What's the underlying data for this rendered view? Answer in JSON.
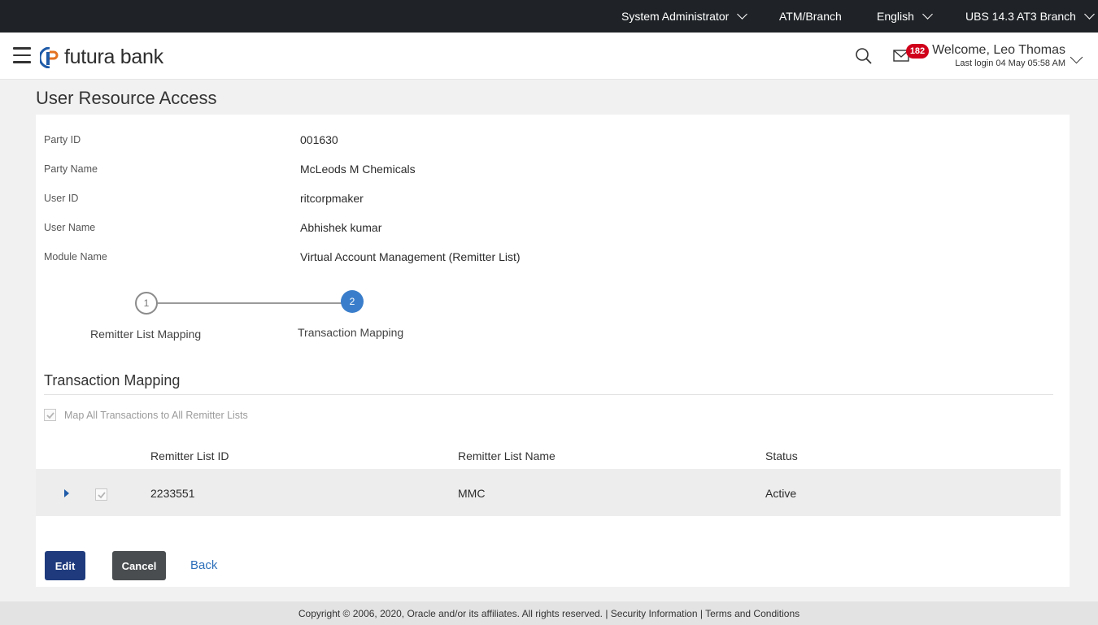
{
  "topbar": {
    "role": "System Administrator",
    "atm_branch": "ATM/Branch",
    "language": "English",
    "branch": "UBS 14.3 AT3 Branch"
  },
  "header": {
    "logo_text": "futura bank",
    "notification_count": "182",
    "welcome": "Welcome, Leo Thomas",
    "last_login": "Last login 04 May 05:58 AM"
  },
  "page": {
    "title": "User Resource Access"
  },
  "details": [
    {
      "label": "Party ID",
      "value": "001630"
    },
    {
      "label": "Party Name",
      "value": "McLeods M Chemicals"
    },
    {
      "label": "User ID",
      "value": "ritcorpmaker"
    },
    {
      "label": "User Name",
      "value": "Abhishek kumar"
    },
    {
      "label": "Module Name",
      "value": "Virtual Account Management (Remitter List)"
    }
  ],
  "stepper": {
    "steps": [
      {
        "number": "1",
        "label": "Remitter List Mapping"
      },
      {
        "number": "2",
        "label": "Transaction Mapping"
      }
    ]
  },
  "mapping": {
    "section_title": "Transaction Mapping",
    "map_all_label": "Map All Transactions to All Remitter Lists",
    "columns": [
      "Remitter List ID",
      "Remitter List Name",
      "Status"
    ],
    "rows": [
      {
        "id": "2233551",
        "name": "MMC",
        "status": "Active"
      }
    ]
  },
  "actions": {
    "edit": "Edit",
    "cancel": "Cancel",
    "back": "Back"
  },
  "footer": {
    "text": "Copyright © 2006, 2020, Oracle and/or its affiliates. All rights reserved. | Security Information | Terms and Conditions"
  },
  "colors": {
    "topbar": "#1f2327",
    "primary_button": "#1f3b7d",
    "step_active": "#3a7ecb",
    "badge": "#d0021b"
  }
}
